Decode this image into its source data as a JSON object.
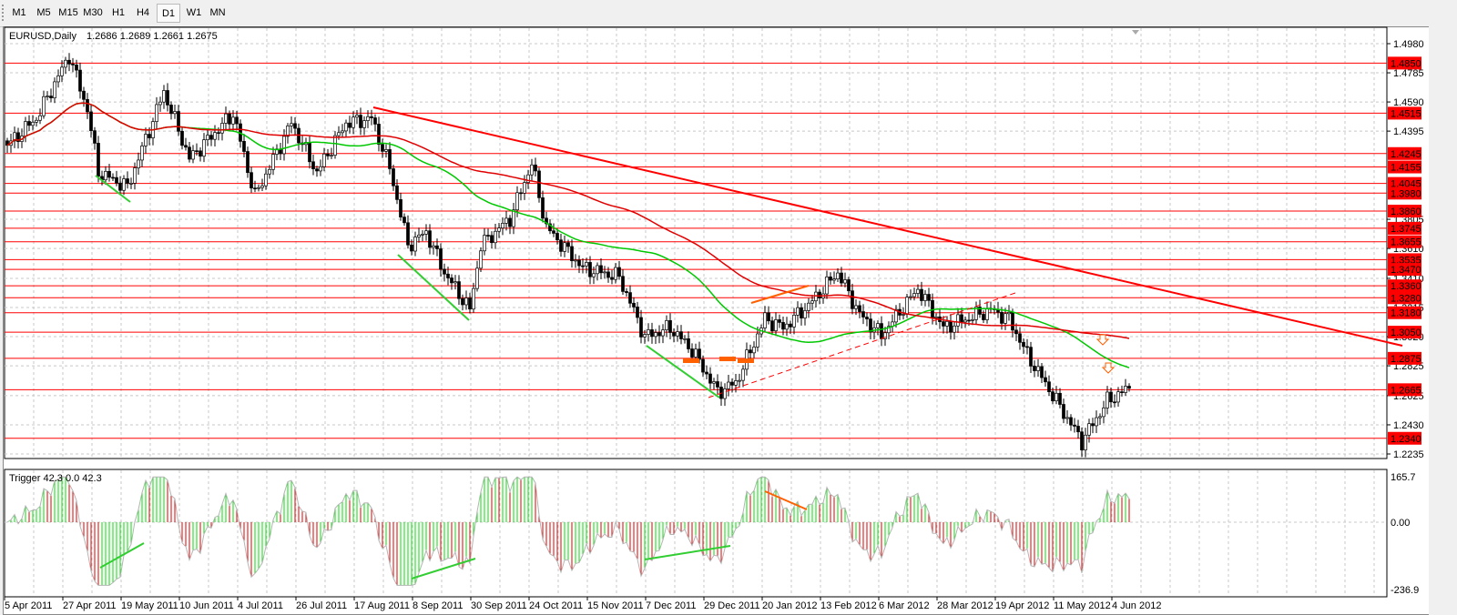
{
  "toolbar": {
    "timeframes": [
      "M1",
      "M5",
      "M15",
      "M30",
      "H1",
      "H4",
      "D1",
      "W1",
      "MN"
    ],
    "active": "D1"
  },
  "chart_data": {
    "type": "candlestick",
    "title": "EURUSD,Daily",
    "ohlc": "1.2686 1.2689 1.2661 1.2675",
    "ylim": [
      1.2235,
      1.498
    ],
    "y_ticks": [
      "1.4980",
      "1.4785",
      "1.4590",
      "1.4395",
      "1.3805",
      "1.3610",
      "1.3410",
      "1.3215",
      "1.3020",
      "1.2825",
      "1.2625",
      "1.2430",
      "1.2235"
    ],
    "levels": [
      "1.4850",
      "1.4515",
      "1.4245",
      "1.4155",
      "1.4045",
      "1.3980",
      "1.3860",
      "1.3745",
      "1.3655",
      "1.3535",
      "1.3470",
      "1.3360",
      "1.3280",
      "1.3180",
      "1.3050",
      "1.2875",
      "1.2665",
      "1.2340"
    ],
    "x_labels": [
      "5 Apr 2011",
      "27 Apr 2011",
      "19 May 2011",
      "10 Jun 2011",
      "4 Jul 2011",
      "26 Jul 2011",
      "17 Aug 2011",
      "8 Sep 2011",
      "30 Sep 2011",
      "24 Oct 2011",
      "15 Nov 2011",
      "7 Dec 2011",
      "29 Dec 2011",
      "20 Jan 2012",
      "13 Feb 2012",
      "6 Mar 2012",
      "28 Mar 2012",
      "19 Apr 2012",
      "11 May 2012",
      "4 Jun 2012"
    ],
    "close_path": [
      [
        0,
        1.43
      ],
      [
        8,
        1.448
      ],
      [
        17,
        1.49
      ],
      [
        22,
        1.454
      ],
      [
        25,
        1.412
      ],
      [
        33,
        1.402
      ],
      [
        43,
        1.466
      ],
      [
        50,
        1.421
      ],
      [
        62,
        1.451
      ],
      [
        68,
        1.396
      ],
      [
        78,
        1.445
      ],
      [
        85,
        1.412
      ],
      [
        93,
        1.445
      ],
      [
        100,
        1.448
      ],
      [
        105,
        1.415
      ],
      [
        110,
        1.363
      ],
      [
        115,
        1.372
      ],
      [
        120,
        1.345
      ],
      [
        127,
        1.32
      ],
      [
        130,
        1.363
      ],
      [
        138,
        1.381
      ],
      [
        144,
        1.418
      ],
      [
        148,
        1.375
      ],
      [
        158,
        1.348
      ],
      [
        168,
        1.342
      ],
      [
        175,
        1.302
      ],
      [
        182,
        1.308
      ],
      [
        188,
        1.293
      ],
      [
        195,
        1.265
      ],
      [
        200,
        1.271
      ],
      [
        208,
        1.314
      ],
      [
        213,
        1.308
      ],
      [
        220,
        1.323
      ],
      [
        228,
        1.345
      ],
      [
        234,
        1.317
      ],
      [
        240,
        1.303
      ],
      [
        250,
        1.334
      ],
      [
        257,
        1.308
      ],
      [
        270,
        1.32
      ],
      [
        275,
        1.314
      ],
      [
        280,
        1.29
      ],
      [
        288,
        1.259
      ],
      [
        295,
        1.232
      ],
      [
        302,
        1.259
      ],
      [
        308,
        1.2675
      ]
    ],
    "ma_periods": {
      "green": 50,
      "red": 100
    },
    "indicator": {
      "name": "Trigger",
      "values": "42.3 0.0 42.3",
      "label": "Trigger 42.3 0.0 42.3",
      "top": "165.7",
      "zero": "0.00",
      "bottom": "-236.9",
      "max": 165.7,
      "min": -236.9
    }
  },
  "colors": {
    "level": "#ff0000",
    "trend": "#ff0000",
    "ma_green": "#00c800",
    "ma_red": "#e00000",
    "bull_hist": "#00e000",
    "bear_hist": "#e00000",
    "orange": "#ff6000"
  }
}
